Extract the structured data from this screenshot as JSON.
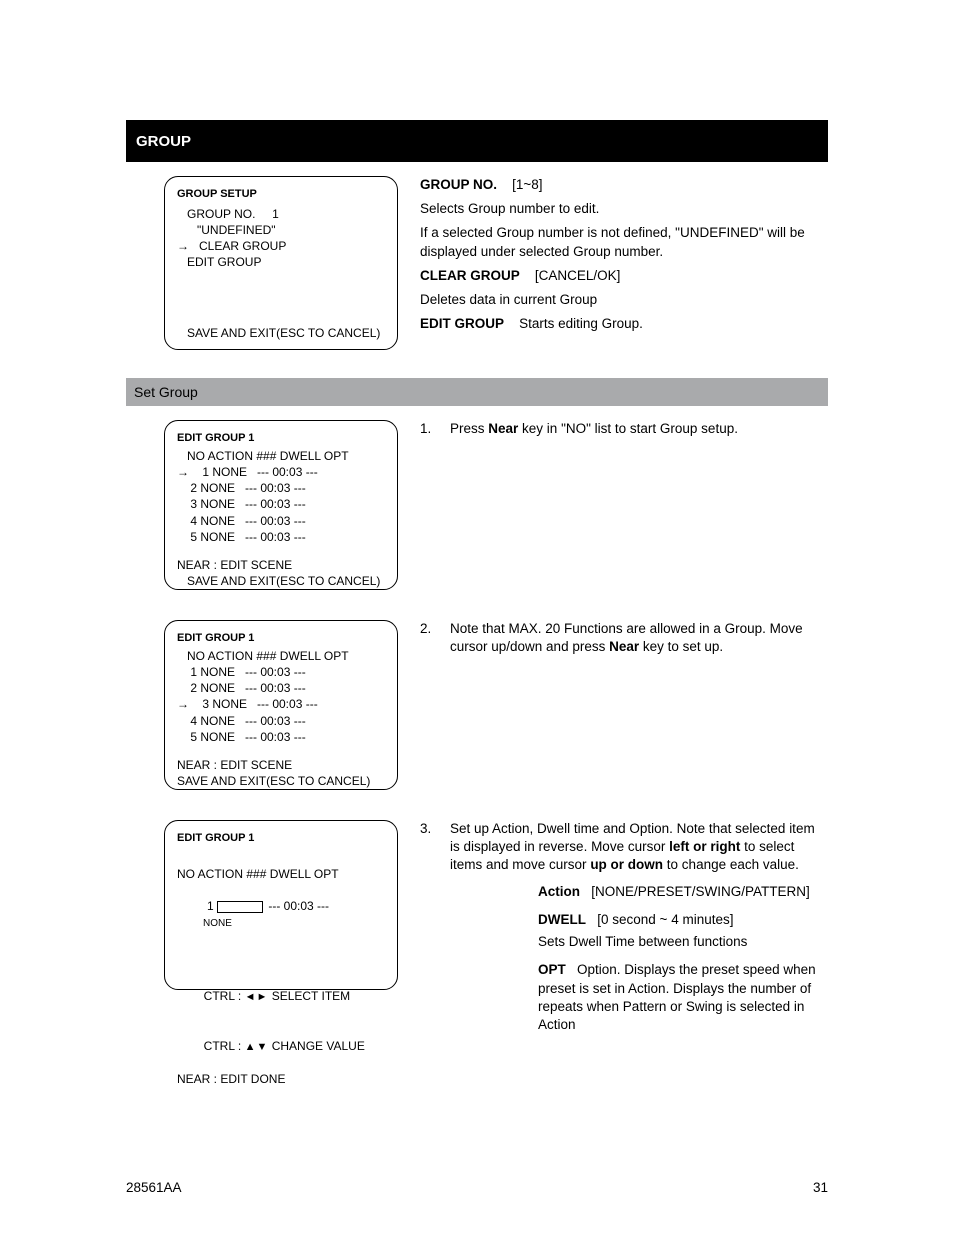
{
  "sectionBar": "GROUP",
  "subBar": "Set Group",
  "topRight": {
    "t1a": "GROUP NO.",
    "t1b": "[1~8]",
    "t2": "Selects Group number to edit.",
    "t3": "If a selected Group number is not defined, \"UNDEFINED\" will be displayed under selected Group number.",
    "t4a": "CLEAR GROUP",
    "t4b": "[CANCEL/OK]",
    "t5": "Deletes data in current Group",
    "t6a": "EDIT GROUP",
    "t6b": "Starts editing Group."
  },
  "panel1": {
    "title": "GROUP SETUP",
    "l1": "   GROUP NO.     1",
    "l2": "      \"UNDEFINED\"",
    "l3": "   CLEAR GROUP",
    "l4": "   EDIT GROUP",
    "l5": "   SAVE AND EXIT(ESC TO CANCEL)"
  },
  "panel2": {
    "title": "EDIT GROUP 1",
    "h": "   NO ACTION ### DWELL OPT",
    "r1": "    1 NONE   --- 00:03 ---",
    "r2": "    2 NONE   --- 00:03 ---",
    "r3": "    3 NONE   --- 00:03 ---",
    "r4": "    4 NONE   --- 00:03 ---",
    "r5": "    5 NONE   --- 00:03 ---",
    "btm": "   SAVE AND EXIT(ESC TO CANCEL)",
    "nearBtm": "NEAR : EDIT SCENE"
  },
  "panel3": {
    "title": "EDIT GROUP 1",
    "h": "   NO ACTION ### DWELL OPT",
    "r1": "    1 NONE   --- 00:03 ---",
    "r2": "    2 NONE   --- 00:03 ---",
    "r3": "    3 NONE   --- 00:03 ---",
    "r4": "    4 NONE   --- 00:03 ---",
    "r5": "    5 NONE   --- 00:03 ---",
    "btm": "SAVE AND EXIT(ESC TO CANCEL)",
    "nearBtm": "NEAR : EDIT SCENE"
  },
  "panel4": {
    "title": "EDIT GROUP 1",
    "h": "NO ACTION ### DWELL OPT",
    "r1": " 1          --- 00:03 ---",
    "boxText": "NONE",
    "hint1pre": "CTRL : ",
    "hint1": "SELECT ITEM",
    "hint2pre": "CTRL : ",
    "hint2": "CHANGE VALUE",
    "nearBtm": "NEAR : EDIT DONE"
  },
  "step1": {
    "num": "1.",
    "pre": "Press ",
    "bold": "Near",
    "post": " key in \"NO\" list to start Group setup."
  },
  "step2": {
    "num": "2.",
    "pre": "Note that MAX. 20 Functions are allowed in a Group. Move cursor up/down and press ",
    "bold": "Near",
    "post": " key to set up."
  },
  "step3": {
    "num": "3.",
    "textA": "Set up Action, Dwell time and Option. Note that selected item is displayed in reverse. Move cursor ",
    "boldA": "left or right",
    "textB": " to select items and move cursor ",
    "boldB": "up or down",
    "textC": " to change each value.",
    "act_lab": "Action",
    "act_opts": "[NONE/PRESET/SWING/PATTERN]",
    "dw_lab": "DWELL",
    "dw_opts": "[0 second ~ 4 minutes]",
    "dw_desc": "Sets Dwell Time between functions",
    "opt_lab": "OPT",
    "opt_desc": "Option. Displays the preset speed when preset is set in Action. Displays the number of repeats when Pattern or Swing is selected in Action"
  },
  "footerLeft": "28561AA",
  "footerRight": "31"
}
